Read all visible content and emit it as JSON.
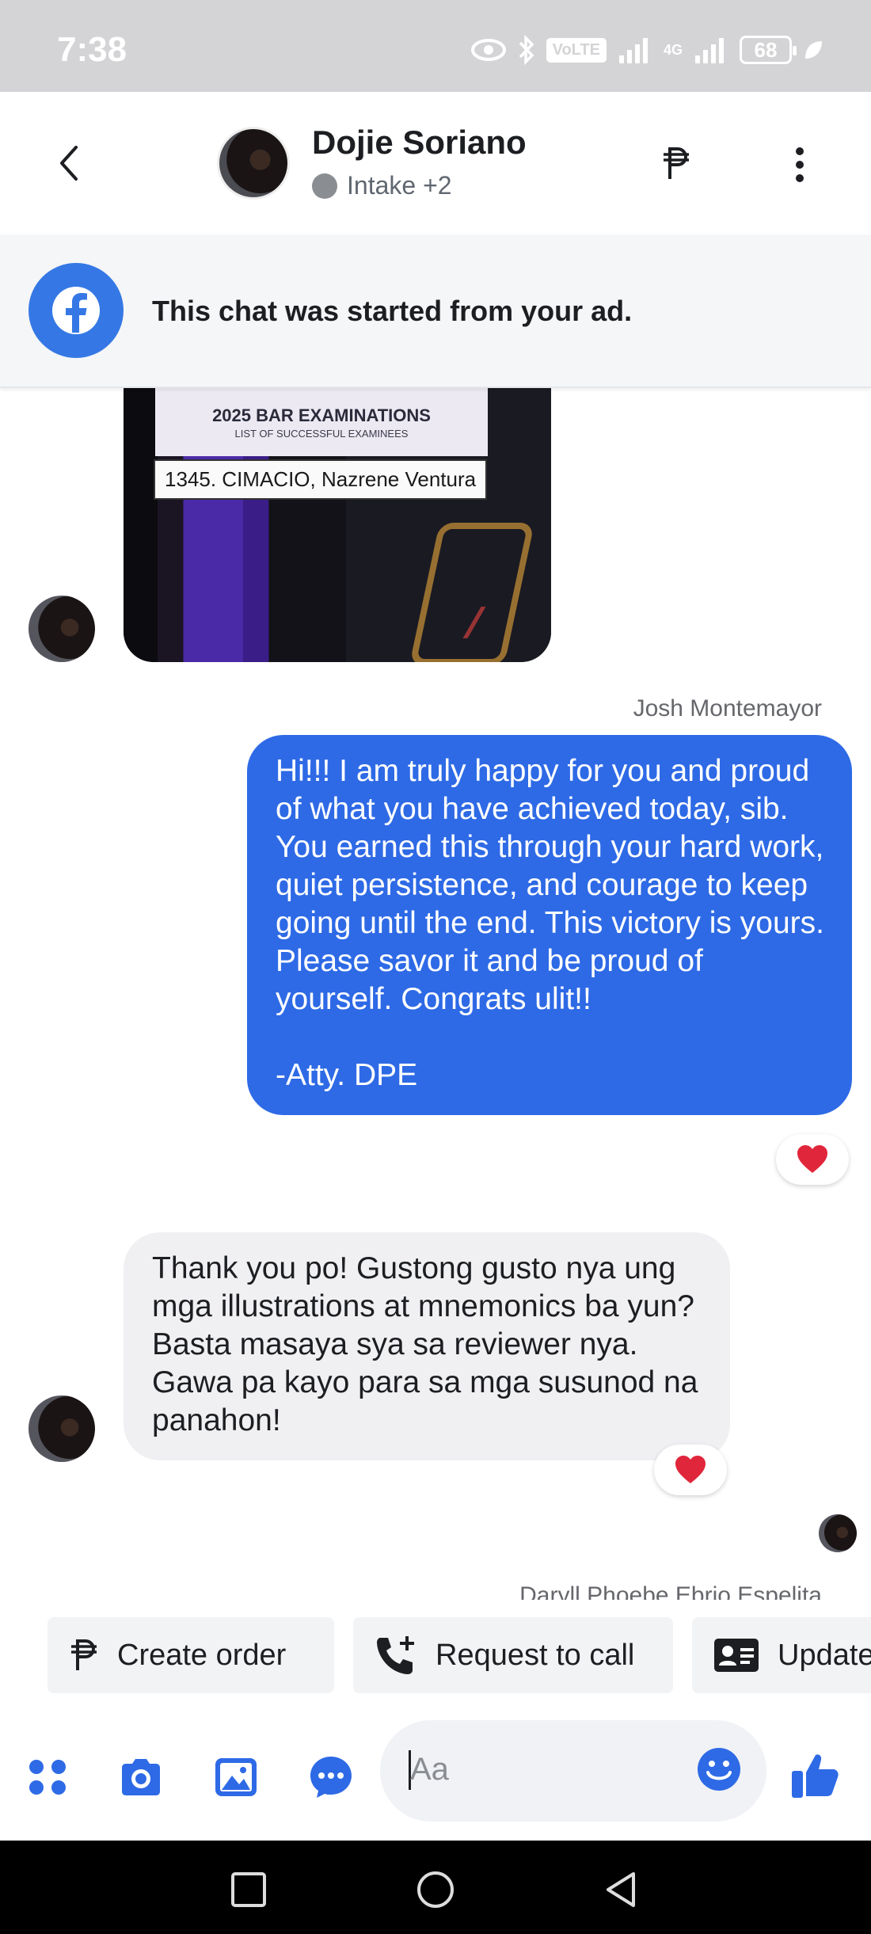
{
  "status_bar": {
    "time": "7:38",
    "volte": "VoLTE",
    "network": "4G",
    "battery": "68"
  },
  "header": {
    "contact_name": "Dojie Soriano",
    "contact_sub": "Intake +2",
    "icons": [
      "back-arrow-icon",
      "peso-icon",
      "more-vertical-icon"
    ]
  },
  "ad_banner": {
    "text": "This chat was started from your ad."
  },
  "messages": {
    "photo": {
      "sign_title": "2025 BAR EXAMINATIONS",
      "sign_subtitle": "LIST OF SUCCESSFUL EXAMINEES",
      "name_card": "1345. CIMACIO, Nazrene Ventura"
    },
    "outgoing": {
      "sender": "Josh Montemayor",
      "text": "Hi!!! I am truly happy for you and proud of what you have achieved today, sib. You earned this through your hard work, quiet persistence, and courage to keep going until the end. This victory is yours. Please savor it and be proud of yourself. Congrats ulit!!\n\n-Atty. DPE",
      "reaction": "heart"
    },
    "incoming": {
      "text": "Thank you po! Gustong gusto nya ung mga illustrations at mnemonics ba yun? Basta masaya sya sa reviewer nya. Gawa pa kayo para sa mga susunod na panahon!",
      "reaction": "heart"
    },
    "next_sender": "Daryll Phoebe Ebrio Espelita"
  },
  "quick_actions": [
    {
      "label": "Create order",
      "icon": "peso-icon"
    },
    {
      "label": "Request to call",
      "icon": "phone-add-icon"
    },
    {
      "label": "Update",
      "icon": "contact-card-icon"
    }
  ],
  "composer": {
    "placeholder": "Aa",
    "icons": [
      "apps-icon",
      "camera-icon",
      "gallery-icon",
      "chat-bubble-icon",
      "emoji-icon",
      "thumbs-up-icon"
    ]
  },
  "colors": {
    "accent": "#2e6ae6",
    "brand": "#3578e5",
    "incoming_bubble": "#f0f0f2",
    "reaction_heart": "#e0263b"
  }
}
